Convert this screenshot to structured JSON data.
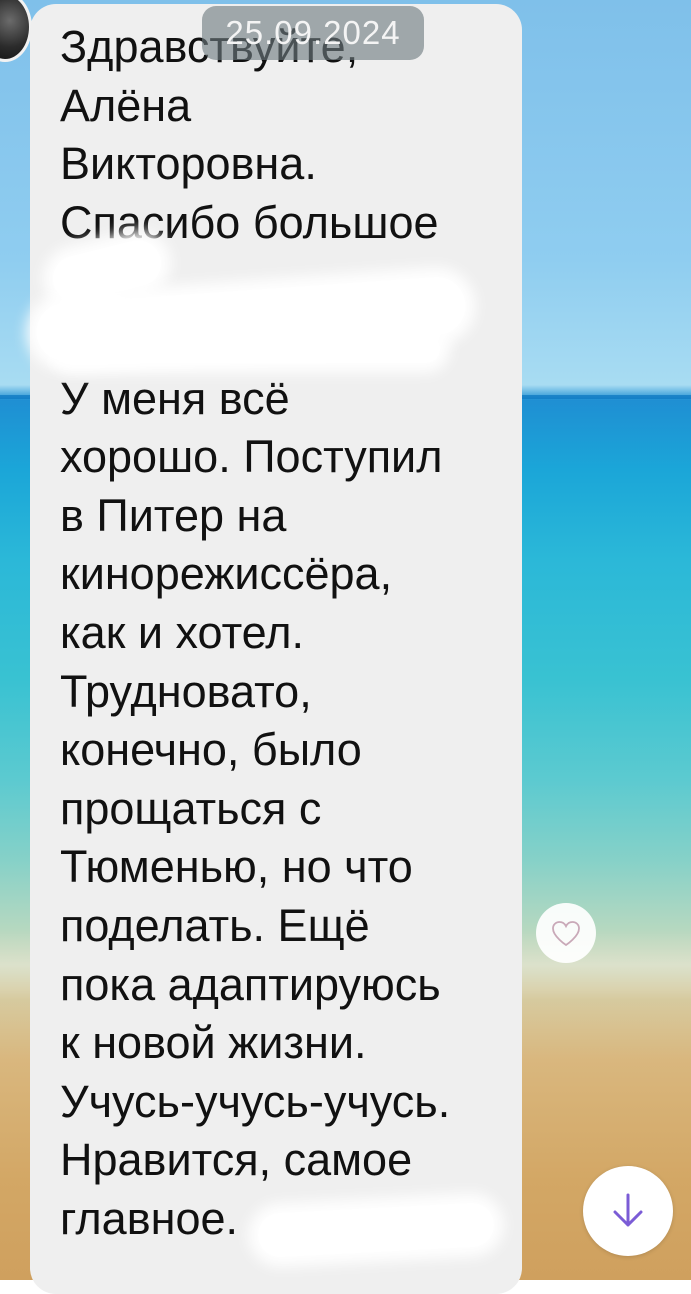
{
  "chat": {
    "date_badge": "25.09.2024",
    "message_lines": [
      "Здравствуйте,",
      "Алёна",
      "Викторовна.",
      "Спасибо большое",
      "",
      "",
      "У меня всё",
      "хорошо. Поступил",
      "в Питер на",
      "кинорежиссёра,",
      "как и хотел.",
      "Трудновато,",
      "конечно, было",
      "прощаться с",
      "Тюменью, но что",
      "поделать. Ещё",
      "пока адаптируюсь",
      "к новой жизни.",
      "Учусь-учусь-учусь.",
      "Нравится, самое",
      "главное."
    ]
  },
  "icons": {
    "like": "heart-icon",
    "scroll_down": "arrow-down-icon"
  },
  "colors": {
    "bubble": "#efefef",
    "text": "#111111",
    "accent": "#7b5cd6",
    "heart_outline": "#c9a9b8"
  }
}
